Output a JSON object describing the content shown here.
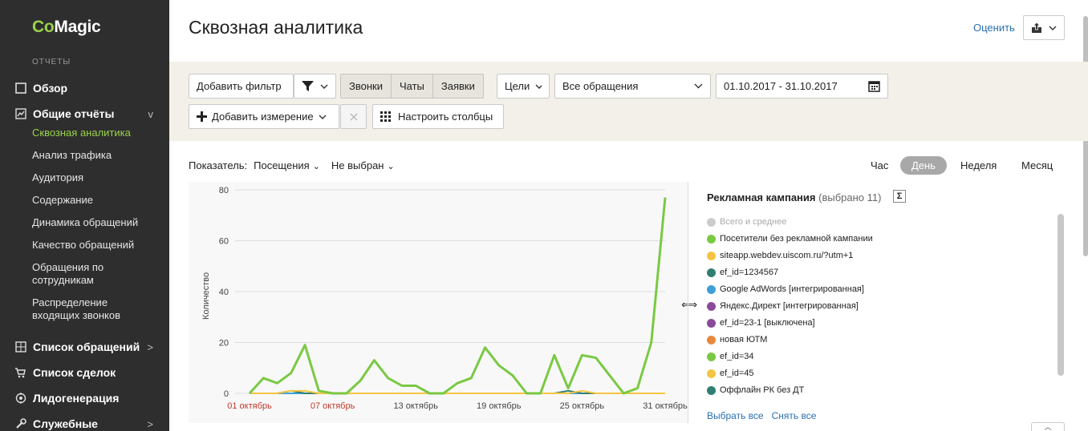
{
  "sidebar": {
    "logo_prefix": "Co",
    "logo_suffix": "Magic",
    "section_title": "ОТЧЕТЫ",
    "items": [
      {
        "label": "Обзор",
        "icon": "square-icon"
      },
      {
        "label": "Общие отчёты",
        "icon": "chart-icon",
        "chevron": "v"
      },
      {
        "label": "Список обращений",
        "icon": "grid-icon",
        "chevron": ">"
      },
      {
        "label": "Список сделок",
        "icon": "cart-icon"
      },
      {
        "label": "Лидогенерация",
        "icon": "target-icon"
      },
      {
        "label": "Служебные",
        "icon": "wrench-icon",
        "chevron": ">"
      }
    ],
    "sub_items": [
      "Сквозная аналитика",
      "Анализ трафика",
      "Аудитория",
      "Содержание",
      "Динамика обращений",
      "Качество обращений",
      "Обращения по сотрудникам",
      "Распределение входящих звонков"
    ]
  },
  "header": {
    "title": "Сквозная аналитика",
    "rate_label": "Оценить",
    "export_icon": "share-icon"
  },
  "toolbar": {
    "add_filter": "Добавить фильтр",
    "filter_icon": "funnel-icon",
    "segments": [
      "Звонки",
      "Чаты",
      "Заявки"
    ],
    "goals": "Цели",
    "requests_select": "Все обращения",
    "date_range": "01.10.2017 - 31.10.2017",
    "add_dimension": "Добавить измерение",
    "configure_columns": "Настроить столбцы"
  },
  "indicator": {
    "label": "Показатель:",
    "metric": "Посещения",
    "second": "Не выбран"
  },
  "periods": [
    "Час",
    "День",
    "Неделя",
    "Месяц"
  ],
  "active_period": "День",
  "chart_data": {
    "type": "line",
    "ylabel": "Количество",
    "ylim": [
      0,
      80
    ],
    "yticks": [
      0,
      20,
      40,
      60,
      80
    ],
    "xticks": [
      {
        "label": "01 октябрь",
        "weekend": true
      },
      {
        "label": "07 октябрь",
        "weekend": true
      },
      {
        "label": "13 октябрь",
        "weekend": false
      },
      {
        "label": "19 октябрь",
        "weekend": false
      },
      {
        "label": "25 октябрь",
        "weekend": false
      },
      {
        "label": "31 октябрь",
        "weekend": false
      }
    ],
    "x": [
      1,
      2,
      3,
      4,
      5,
      6,
      7,
      8,
      9,
      10,
      11,
      12,
      13,
      14,
      15,
      16,
      17,
      18,
      19,
      20,
      21,
      22,
      23,
      24,
      25,
      26,
      27,
      28,
      29,
      30,
      31
    ],
    "series": [
      {
        "name": "Посетители без рекламной кампании",
        "color": "#7ac943",
        "values": [
          0,
          6,
          4,
          8,
          19,
          1,
          0,
          0,
          5,
          13,
          6,
          3,
          3,
          0,
          0,
          4,
          6,
          18,
          11,
          7,
          0,
          0,
          15,
          2,
          15,
          14,
          7,
          0,
          2,
          20,
          77
        ]
      },
      {
        "name": "siteapp.webdev.uiscom.ru/?utm+1",
        "color": "#f5c542",
        "values": [
          0,
          0,
          0,
          1,
          1,
          0,
          0,
          0,
          0,
          0,
          0,
          0,
          0,
          0,
          0,
          0,
          0,
          0,
          0,
          0,
          0,
          0,
          0,
          0,
          1,
          0,
          0,
          0,
          0,
          0,
          0
        ]
      },
      {
        "name": "ef_id=1234567",
        "color": "#2f7f72",
        "values": [
          0,
          0,
          0,
          1,
          0,
          0,
          0,
          0,
          0,
          0,
          0,
          0,
          0,
          0,
          0,
          0,
          0,
          0,
          0,
          0,
          0,
          0,
          0,
          1,
          0,
          0,
          0,
          0,
          0,
          0,
          0
        ]
      },
      {
        "name": "Google AdWords [интегрированная]",
        "color": "#3fa0d8",
        "values": [
          0,
          0,
          0,
          0,
          0,
          0,
          0,
          0,
          0,
          0,
          0,
          0,
          0,
          0,
          0,
          0,
          0,
          0,
          0,
          0,
          0,
          0,
          0,
          0,
          0,
          0,
          0,
          0,
          0,
          0,
          0
        ]
      }
    ]
  },
  "legend": {
    "title": "Рекламная кампания",
    "count": "(выбрано 11)",
    "sigma": "Σ",
    "items": [
      {
        "label": "Всего и среднее",
        "color": "#cccccc",
        "muted": true
      },
      {
        "label": "Посетители без рекламной кампании",
        "color": "#7ac943"
      },
      {
        "label": "siteapp.webdev.uiscom.ru/?utm+1",
        "color": "#f5c542"
      },
      {
        "label": "ef_id=1234567",
        "color": "#2f7f72"
      },
      {
        "label": "Google AdWords [интегрированная]",
        "color": "#3fa0d8"
      },
      {
        "label": "Яндекс.Директ [интегрированная]",
        "color": "#8a4a9a"
      },
      {
        "label": "ef_id=23-1 [выключена]",
        "color": "#8a4a9a"
      },
      {
        "label": "новая ЮТМ",
        "color": "#e8883a"
      },
      {
        "label": "ef_id=34",
        "color": "#7ac943"
      },
      {
        "label": "ef_id=45",
        "color": "#f5c542"
      },
      {
        "label": "Оффлайн РК без ДТ",
        "color": "#2f7f72"
      }
    ],
    "select_all": "Выбрать все",
    "deselect_all": "Снять все"
  }
}
